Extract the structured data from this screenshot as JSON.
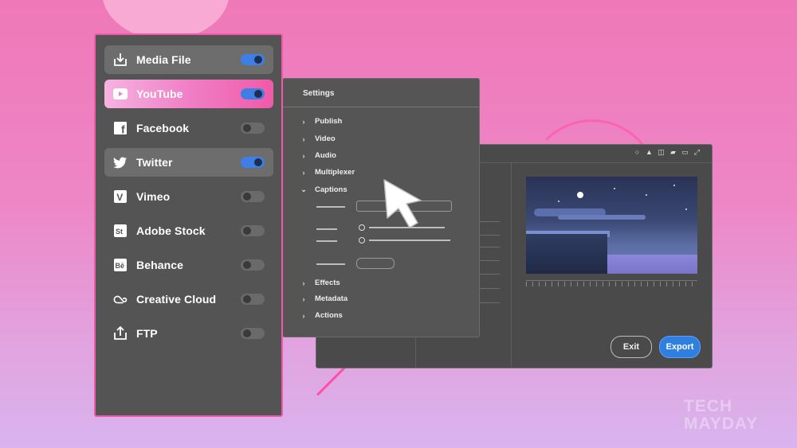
{
  "sidebar": {
    "items": [
      {
        "label": "Media File",
        "icon": "download-icon",
        "enabled": true
      },
      {
        "label": "YouTube",
        "icon": "youtube-icon",
        "enabled": true
      },
      {
        "label": "Facebook",
        "icon": "facebook-icon",
        "enabled": false
      },
      {
        "label": "Twitter",
        "icon": "twitter-icon",
        "enabled": true
      },
      {
        "label": "Vimeo",
        "icon": "vimeo-icon",
        "enabled": false
      },
      {
        "label": "Adobe Stock",
        "icon": "adobe-stock-icon",
        "enabled": false
      },
      {
        "label": "Behance",
        "icon": "behance-icon",
        "enabled": false
      },
      {
        "label": "Creative Cloud",
        "icon": "creative-cloud-icon",
        "enabled": false
      },
      {
        "label": "FTP",
        "icon": "upload-icon",
        "enabled": false
      }
    ],
    "icon_glyphs": {
      "vimeo": "V",
      "stock": "St",
      "behance": "Bē",
      "facebook": "f"
    }
  },
  "settings": {
    "title": "Settings",
    "sections": [
      "Publish",
      "Video",
      "Audio",
      "Multiplexer",
      "Captions",
      "Effects",
      "Metadata",
      "Actions"
    ],
    "expanded": "Captions"
  },
  "export_window": {
    "exit_label": "Exit",
    "export_label": "Export"
  },
  "watermark": {
    "line1": "TECH",
    "line2": "MAYDAY"
  },
  "colors": {
    "accent": "#3d7fe6",
    "highlight": "#f05aa8",
    "panel": "#545454"
  }
}
